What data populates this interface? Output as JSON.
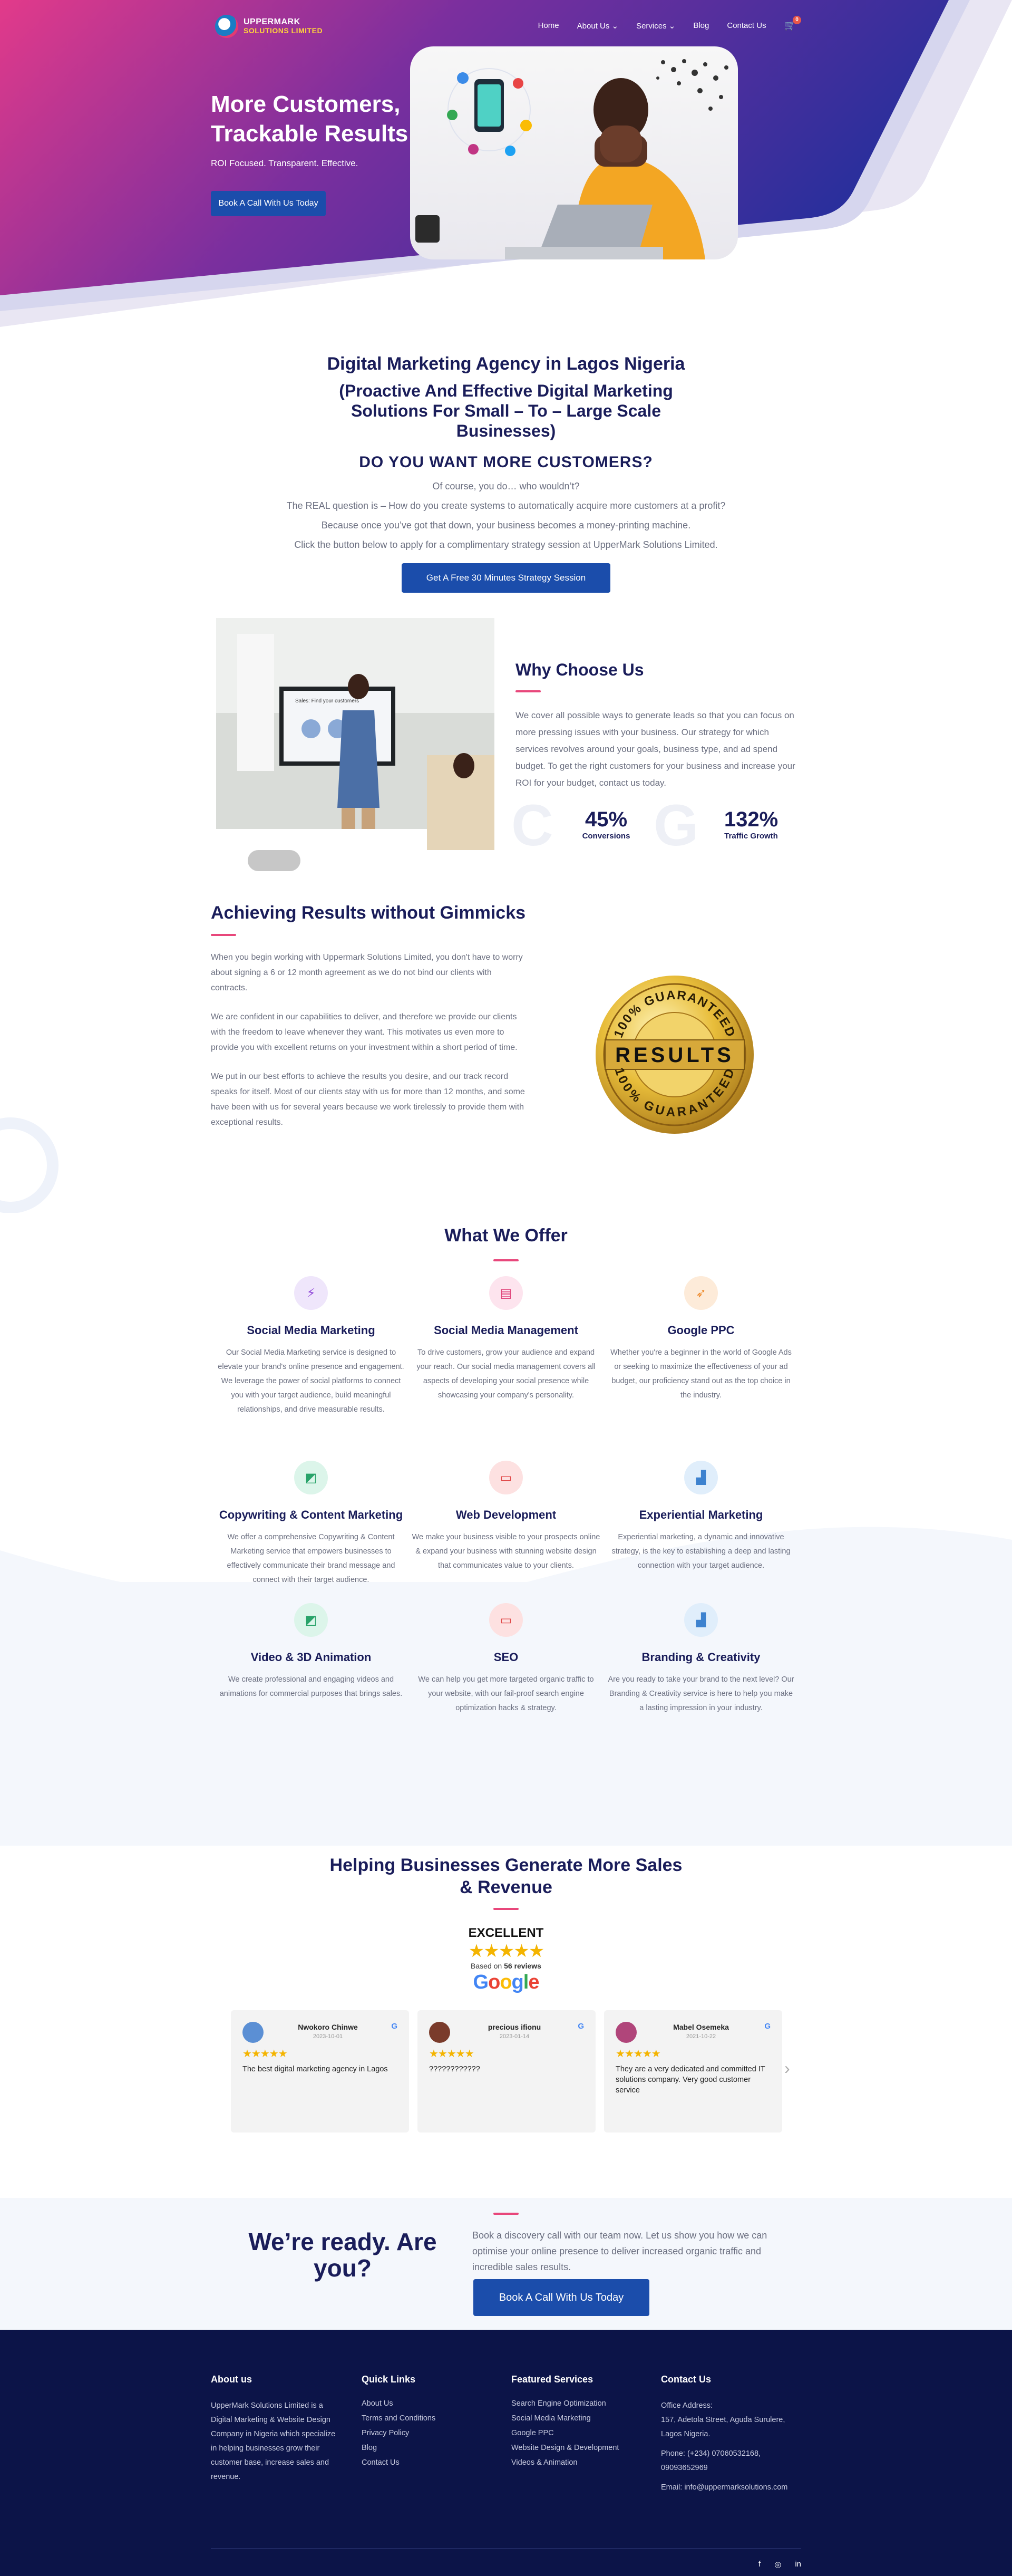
{
  "nav": {
    "logo_line1": "UPPERMARK",
    "logo_line2": "SOLUTIONS LIMITED",
    "items": [
      "Home",
      "About Us ⌄",
      "Services ⌄",
      "Blog",
      "Contact Us"
    ],
    "cart_count": "0"
  },
  "hero": {
    "title": "More Customers, Trackable Results",
    "tagline": "ROI Focused. Transparent. Effective.",
    "button": "Book A Call With Us Today"
  },
  "intro": {
    "title1": "Digital Marketing Agency in Lagos Nigeria",
    "title2": "(Proactive And Effective Digital Marketing Solutions For Small – To – Large Scale Businesses)",
    "title3": "DO YOU WANT MORE CUSTOMERS?",
    "lines": [
      "Of course, you do… who wouldn’t?",
      "The REAL question is – How do you create systems to automatically acquire more customers at a profit?",
      "Because once you’ve got that down, your business becomes a money-printing machine.",
      "Click the button below to apply for a complimentary strategy session at UpperMark Solutions Limited."
    ],
    "button": "Get A Free 30 Minutes Strategy Session"
  },
  "why": {
    "title": "Why Choose Us",
    "text": "We cover all possible ways to generate leads so that you can focus on more pressing issues with your business. Our strategy for which services revolves around your goals, business type, and ad spend budget. To get the right customers for your business and increase your ROI for your budget, contact us today.",
    "screen_text": "Sales: Find your customers",
    "stats": [
      {
        "value": "45%",
        "label": "Conversions",
        "ghost": "C"
      },
      {
        "value": "132%",
        "label": "Traffic Growth",
        "ghost": "G"
      }
    ]
  },
  "achieve": {
    "title": "Achieving Results without Gimmicks",
    "paras": [
      "When you begin working with Uppermark Solutions Limited, you don't have to worry about signing a 6 or 12 month agreement as we do not bind our clients with contracts.",
      "We are confident in our capabilities to deliver, and therefore we provide our clients with the freedom to leave whenever they want. This motivates us even more to provide you with excellent returns on your investment within a short period of time.",
      "We put in our best efforts to achieve the results you desire, and our track record speaks for itself. Most of our clients stay with us for more than 12 months, and some have been with us for several years because we work tirelessly to provide them with exceptional results."
    ],
    "badge_top": "100% GUARANTEED",
    "badge_mid": "RESULTS",
    "badge_bottom": "100% GUARANTEED"
  },
  "offer": {
    "title": "What We Offer",
    "cards": [
      {
        "title": "Social Media Marketing",
        "text": "Our Social Media Marketing service is designed to elevate your brand's online presence and engagement. We leverage the power of social platforms to connect you with your target audience, build meaningful relationships, and drive measurable results.",
        "icon": "megaphone-icon",
        "glyph": "⚡",
        "bg": "#efe6fb",
        "fg": "#8b3fd6"
      },
      {
        "title": "Social Media Management",
        "text": "To drive customers, grow your audience and expand your reach. Our social media management covers all aspects of developing your social presence while showcasing your company's personality.",
        "icon": "share-icon",
        "glyph": "▤",
        "bg": "#fde4ee",
        "fg": "#e0457b"
      },
      {
        "title": "Google PPC",
        "text": "Whether you're a beginner in the world of Google Ads or seeking to maximize the effectiveness of your ad budget, our proficiency stand out as the top choice in the industry.",
        "icon": "rocket-icon",
        "glyph": "➶",
        "bg": "#fdebd9",
        "fg": "#ee8a2b"
      },
      {
        "title": "Copywriting & Content Marketing",
        "text": "We offer a comprehensive Copywriting & Content Marketing service that empowers businesses to effectively communicate their brand message and connect with their target audience.",
        "icon": "chart-icon",
        "glyph": "◩",
        "bg": "#dcf5ea",
        "fg": "#29a36a"
      },
      {
        "title": "Web Development",
        "text": "We make your business visible to your prospects online & expand your business with stunning website design that communicates value to your clients.",
        "icon": "monitor-icon",
        "glyph": "▭",
        "bg": "#fde1e1",
        "fg": "#e04848"
      },
      {
        "title": "Experiential Marketing",
        "text": "Experiential marketing, a dynamic and innovative strategy, is the key to establishing a deep and lasting connection with your target audience.",
        "icon": "bar-chart-icon",
        "glyph": "▟",
        "bg": "#e0eefb",
        "fg": "#3d82cf"
      },
      {
        "title": "Video & 3D Animation",
        "text": "We create professional and engaging videos and animations for commercial purposes that brings sales.",
        "icon": "chart-icon",
        "glyph": "◩",
        "bg": "#dcf5ea",
        "fg": "#29a36a"
      },
      {
        "title": "SEO",
        "text": "We can help you get more targeted organic traffic to your website, with our fail-proof search engine optimization hacks & strategy.",
        "icon": "monitor-icon",
        "glyph": "▭",
        "bg": "#fde1e1",
        "fg": "#e04848"
      },
      {
        "title": "Branding & Creativity",
        "text": "Are you ready to take your brand to the next level? Our Branding & Creativity service is here to help you make a lasting impression in your industry.",
        "icon": "bar-chart-icon",
        "glyph": "▟",
        "bg": "#e0eefb",
        "fg": "#3d82cf"
      }
    ]
  },
  "reviews": {
    "title": "Helping Businesses Generate More Sales & Revenue",
    "rating_word": "EXCELLENT",
    "stars": "★★★★★",
    "based_on": "Based on",
    "review_count": "56 reviews",
    "google": "Google",
    "items": [
      {
        "name": "Nwokoro Chinwe",
        "date": "2023-10-01",
        "stars": "★★★★★",
        "text": "The best digital marketing agency in Lagos",
        "avatar": "#5b8fd4"
      },
      {
        "name": "precious ifionu",
        "date": "2023-01-14",
        "stars": "★★★★★",
        "text": "????????????",
        "avatar": "#7a3b2b"
      },
      {
        "name": "Mabel Osemeka",
        "date": "2021-10-22",
        "stars": "★★★★★",
        "text": "They are a very dedicated and committed IT solutions company. Very good customer service",
        "avatar": "#b0457a"
      }
    ],
    "next": "›"
  },
  "cta": {
    "title": "We’re ready. Are you?",
    "text": "Book a discovery call with our team now. Let us show you how we can optimise your online presence to deliver increased organic traffic and incredible sales results.",
    "button": "Book A Call With Us Today"
  },
  "footer": {
    "about": {
      "title": "About us",
      "text": "UpperMark Solutions Limited is a Digital Marketing & Website Design Company in Nigeria which specialize in helping businesses grow their customer base, increase sales and revenue."
    },
    "links": {
      "title": "Quick Links",
      "items": [
        "About Us",
        "Terms and Conditions",
        "Privacy Policy",
        "Blog",
        "Contact Us"
      ]
    },
    "services": {
      "title": "Featured Services",
      "items": [
        "Search Engine Optimization",
        "Social Media Marketing",
        "Google PPC",
        "Website Design & Development",
        "Videos & Animation"
      ]
    },
    "contact": {
      "title": "Contact Us",
      "address_label": "Office Address:",
      "address": "157, Adetola Street, Aguda Surulere, Lagos Nigeria.",
      "phone": "Phone: (+234) 07060532168, 09093652969",
      "email": "Email: info@uppermarksolutions.com"
    },
    "social": [
      "f",
      "◎",
      "in"
    ]
  }
}
